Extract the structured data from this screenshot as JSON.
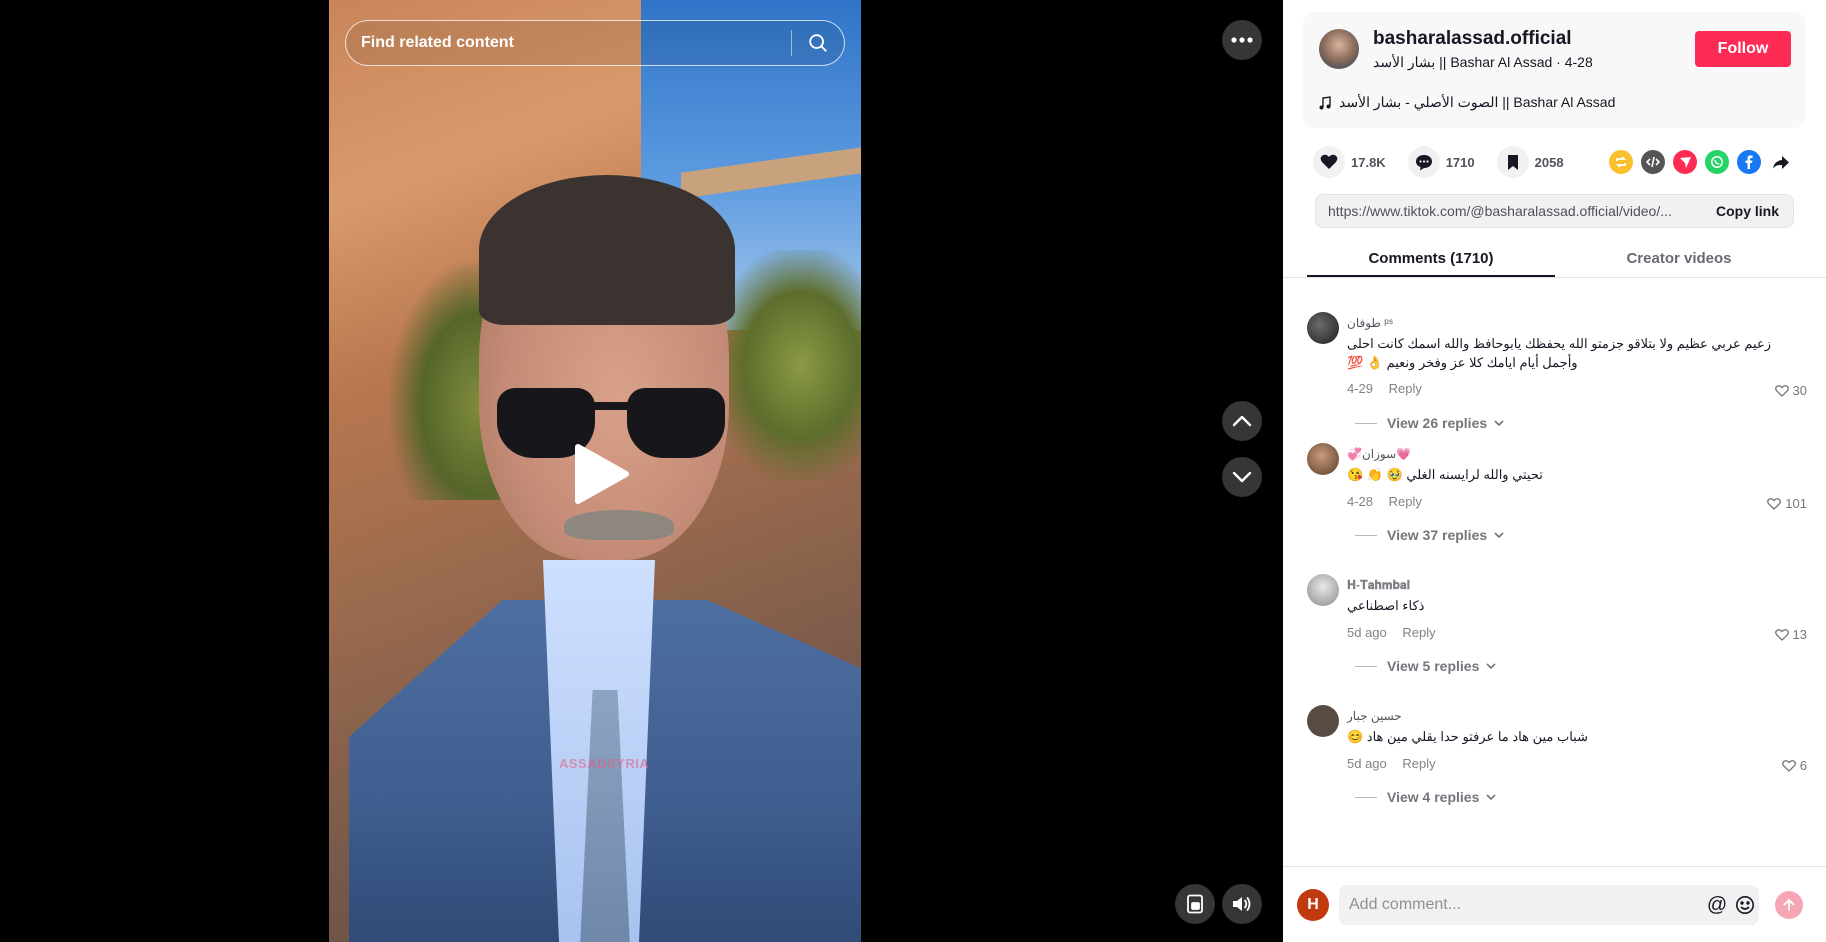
{
  "search": {
    "placeholder": "Find related content"
  },
  "video": {
    "watermark": "ASSADSYRIA"
  },
  "creator": {
    "username": "basharalassad.official",
    "subline": "بشار الأسد || Bashar Al Assad · 4-28",
    "follow_label": "Follow",
    "music": "الصوت الأصلي - بشار الأسد || Bashar Al Assad"
  },
  "stats": {
    "likes": "17.8K",
    "comments": "1710",
    "saves": "2058"
  },
  "share_icons": [
    "repost-icon",
    "embed-icon",
    "send-icon",
    "whatsapp-icon",
    "facebook-icon",
    "share-arrow-icon"
  ],
  "link": {
    "url": "https://www.tiktok.com/@basharalassad.official/video/...",
    "copy_label": "Copy link"
  },
  "tabs": {
    "comments": "Comments (1710)",
    "creator_videos": "Creator videos"
  },
  "comments": [
    {
      "name": "طوفان ᵖˢ",
      "lines": [
        "زعيم عربي عظيم ولا بتلاقو جزمتو الله يحفظك يابوحافظ والله اسمك كانت احلى",
        "وأجمل أيام ايامك كلا عز وفخر ونعيم 👌 💯"
      ],
      "date": "4-29",
      "reply": "Reply",
      "likes": "30",
      "view": "View 26 replies"
    },
    {
      "name": "💞سوزان💗",
      "lines": [
        "تحيتي والله لرايسنه الغلي 🥹 👏 😘"
      ],
      "date": "4-28",
      "reply": "Reply",
      "likes": "101",
      "view": "View 37 replies"
    },
    {
      "name": "𝐇-𝐓𝐚𝐡𝐦𝐛𝐚𝐥",
      "lines": [
        "ذكاء اصطناعي"
      ],
      "date": "5d ago",
      "reply": "Reply",
      "likes": "13",
      "view": "View 5 replies"
    },
    {
      "name": "حسين جبار",
      "lines": [
        "شباب مين هاد ما عرفتو حدا يقلي مين هاد 😊"
      ],
      "date": "5d ago",
      "reply": "Reply",
      "likes": "6",
      "view": "View 4 replies"
    }
  ],
  "comment_bar": {
    "avatar_letter": "H",
    "placeholder": "Add comment...",
    "mention": "@"
  },
  "colors": {
    "accent": "#fe2c55",
    "panel_bg": "#ffffff",
    "stage_bg": "#000000"
  }
}
